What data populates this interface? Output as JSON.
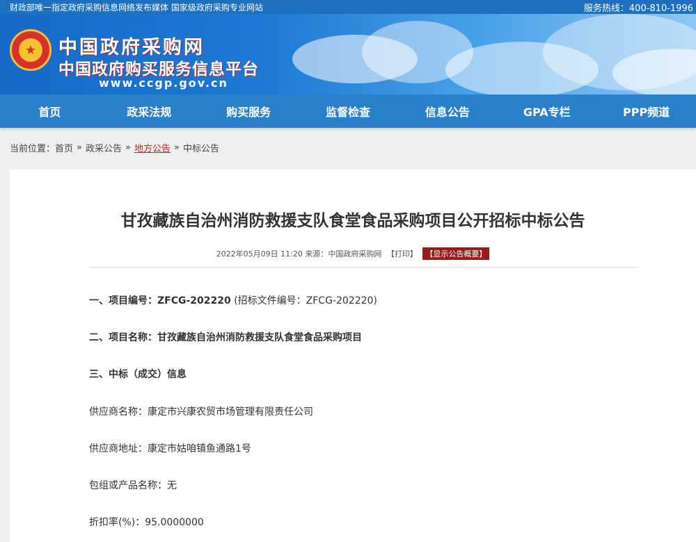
{
  "topbar": {
    "left_text": "财政部唯一指定政府采购信息网络发布媒体 国家级政府采购专业网站",
    "hotline": "服务热线：400-810-1996"
  },
  "banner": {
    "site_name": "中国政府采购网",
    "platform_name": "中国政府购买服务信息平台",
    "url": "www.ccgp.gov.cn"
  },
  "nav": {
    "items": [
      "首页",
      "政采法规",
      "购买服务",
      "监督检查",
      "信息公告",
      "GPA专栏",
      "PPP频道"
    ]
  },
  "breadcrumb": {
    "prefix": "当前位置：",
    "items": [
      "首页",
      "政采公告",
      "地方公告",
      "中标公告"
    ],
    "separator": "»"
  },
  "article": {
    "title": "甘孜藏族自治州消防救援支队食堂食品采购项目公开招标中标公告",
    "meta_date": "2022年05月09日 11:20 来源：中国政府采购网",
    "print_label": "【打印】",
    "summary_label": "【显示公告概要】",
    "section1_label": "一、项目编号：ZFCG-202220",
    "section1_extra": "(招标文件编号：ZFCG-202220)",
    "section2": "二、项目名称：甘孜藏族自治州消防救援支队食堂食品采购项目",
    "section3": "三、中标（成交）信息",
    "supplier_name": "供应商名称：康定市兴康农贸市场管理有限责任公司",
    "supplier_address": "供应商地址：康定市姑咱镇鱼通路1号",
    "package": "包组或产品名称：无",
    "discount": "折扣率(%)：95.0000000"
  }
}
